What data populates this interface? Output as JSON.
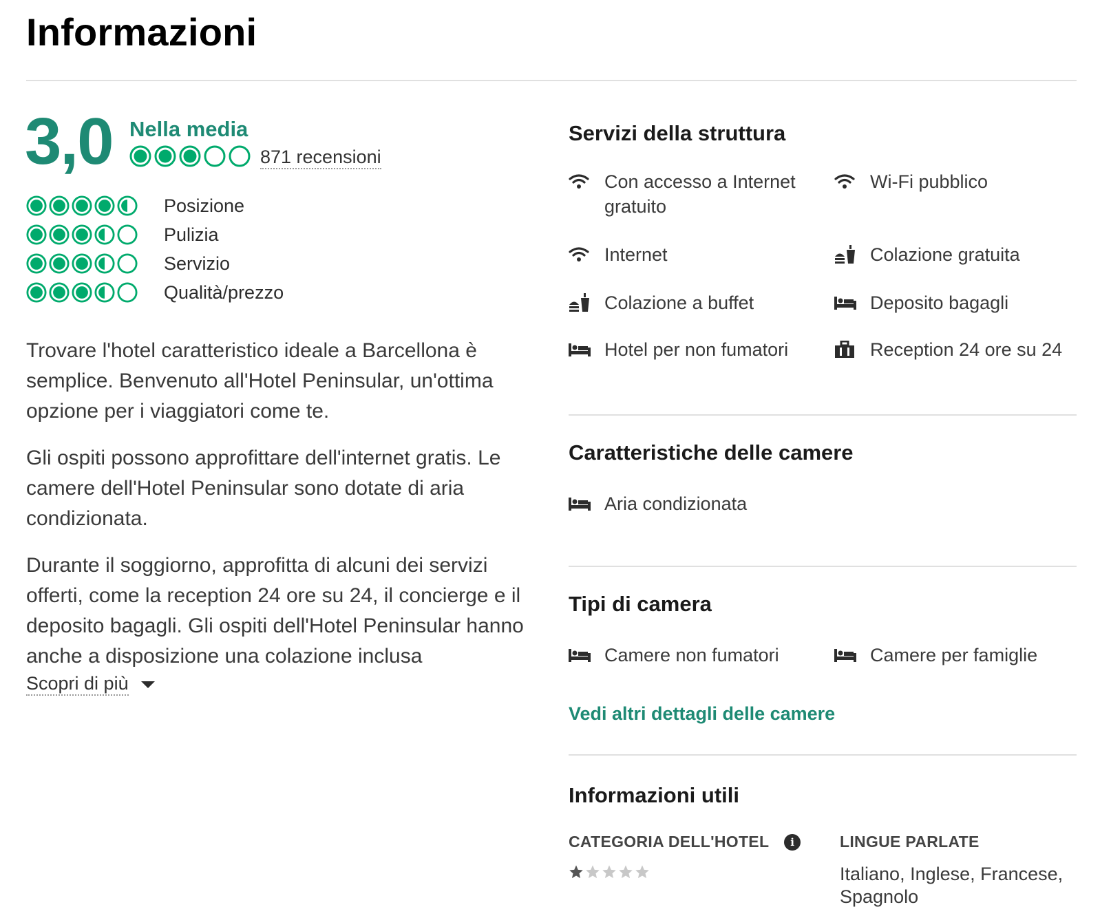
{
  "page_title": "Informazioni",
  "rating": {
    "score": "3,0",
    "word": "Nella media",
    "bubbles": 3,
    "reviews": "871 recensioni",
    "accent_color": "#1e8a74",
    "bubble_color": "#00aa6c"
  },
  "sub_ratings": [
    {
      "label": "Posizione",
      "value": 4.5
    },
    {
      "label": "Pulizia",
      "value": 3.5
    },
    {
      "label": "Servizio",
      "value": 3.5
    },
    {
      "label": "Qualità/prezzo",
      "value": 3.5
    }
  ],
  "description": {
    "paragraphs": [
      "Trovare l'hotel caratteristico ideale a Barcellona è semplice. Benvenuto all'Hotel Peninsular, un'ottima opzione per i viaggiatori come te.",
      "Gli ospiti possono approfittare dell'internet gratis. Le camere dell'Hotel Peninsular sono dotate di aria condizionata.",
      "Durante il soggiorno, approfitta di alcuni dei servizi offerti, come la reception 24 ore su 24, il concierge e il deposito bagagli. Gli ospiti dell'Hotel Peninsular hanno anche a disposizione una colazione inclusa"
    ],
    "more_label": "Scopri di più"
  },
  "property_amenities": {
    "title": "Servizi della struttura",
    "items": [
      {
        "label": "Con accesso a Internet gratuito",
        "icon": "wifi-icon"
      },
      {
        "label": "Wi-Fi pubblico",
        "icon": "wifi-icon"
      },
      {
        "label": "Internet",
        "icon": "wifi-icon"
      },
      {
        "label": "Colazione gratuita",
        "icon": "breakfast-icon"
      },
      {
        "label": "Colazione a buffet",
        "icon": "breakfast-icon"
      },
      {
        "label": "Deposito bagagli",
        "icon": "bed-icon"
      },
      {
        "label": "Hotel per non fumatori",
        "icon": "bed-icon"
      },
      {
        "label": "Reception 24 ore su 24",
        "icon": "suitcase-icon"
      }
    ]
  },
  "room_features": {
    "title": "Caratteristiche delle camere",
    "items": [
      {
        "label": "Aria condizionata",
        "icon": "bed-icon"
      }
    ]
  },
  "room_types": {
    "title": "Tipi di camera",
    "items": [
      {
        "label": "Camere non fumatori",
        "icon": "bed-icon"
      },
      {
        "label": "Camere per famiglie",
        "icon": "bed-icon"
      }
    ],
    "see_more": "Vedi altri dettagli delle camere"
  },
  "useful_info": {
    "title": "Informazioni utili",
    "category_label": "CATEGORIA DELL'HOTEL",
    "info_icon_glyph": "i",
    "stars": 1,
    "languages_label": "LINGUE PARLATE",
    "languages": "Italiano, Inglese, Francese, Spagnolo"
  }
}
